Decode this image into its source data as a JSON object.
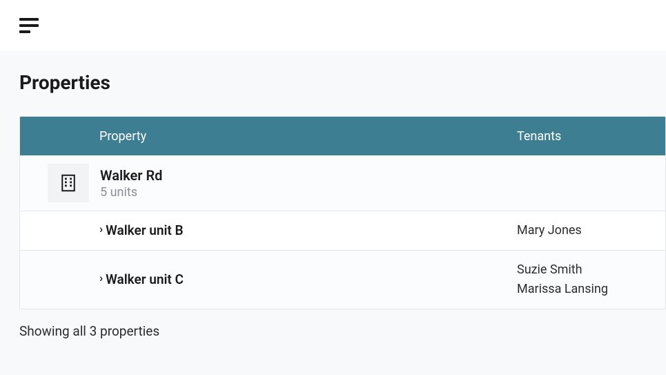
{
  "header": {
    "menu_icon": "hamburger"
  },
  "page": {
    "title": "Properties"
  },
  "table": {
    "columns": {
      "property": "Property",
      "tenants": "Tenants"
    },
    "property": {
      "name": "Walker Rd",
      "subtitle": "5 units"
    },
    "units": [
      {
        "name": "Walker unit B",
        "tenants": [
          "Mary Jones"
        ]
      },
      {
        "name": "Walker unit C",
        "tenants": [
          "Suzie Smith",
          "Marissa Lansing"
        ]
      }
    ]
  },
  "footer": {
    "summary": "Showing all 3 properties"
  }
}
